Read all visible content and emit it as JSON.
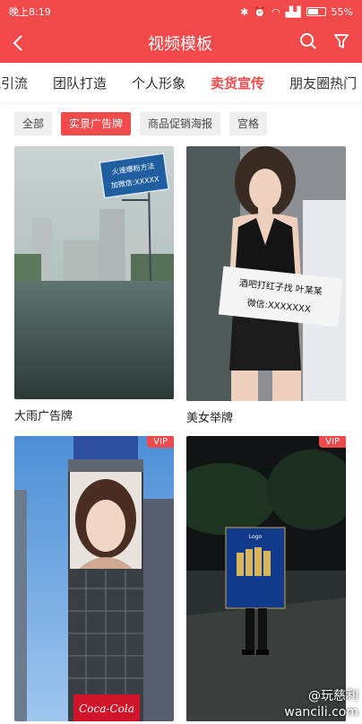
{
  "status": {
    "time": "晚上8:19",
    "battery": "55%",
    "battery_level": 0.55
  },
  "nav": {
    "title": "视频模板"
  },
  "category_tabs": [
    {
      "label": "流引流"
    },
    {
      "label": "团队打造"
    },
    {
      "label": "个人形象"
    },
    {
      "label": "卖货宣传",
      "active": true
    },
    {
      "label": "朋友圈热门"
    }
  ],
  "chips": [
    {
      "label": "全部"
    },
    {
      "label": "实景广告牌",
      "active": true
    },
    {
      "label": "商品促销海报"
    },
    {
      "label": "宫格"
    }
  ],
  "cards": [
    {
      "caption": "大雨广告牌",
      "sign_line1": "火速爆粉方法",
      "sign_line2": "加微信:XXXXX"
    },
    {
      "caption": "美女举牌",
      "sign_line1": "酒吧打红子找 叶某某",
      "sign_line2": "微信:XXXXXXX"
    },
    {
      "vip": "VIP",
      "brand": "Coca-Cola"
    },
    {
      "vip": "VIP",
      "board_text": "Logo"
    }
  ],
  "watermark": {
    "line1": "@玩慈利",
    "line2": "wancili.com"
  },
  "colors": {
    "accent": "#f24a4a"
  }
}
